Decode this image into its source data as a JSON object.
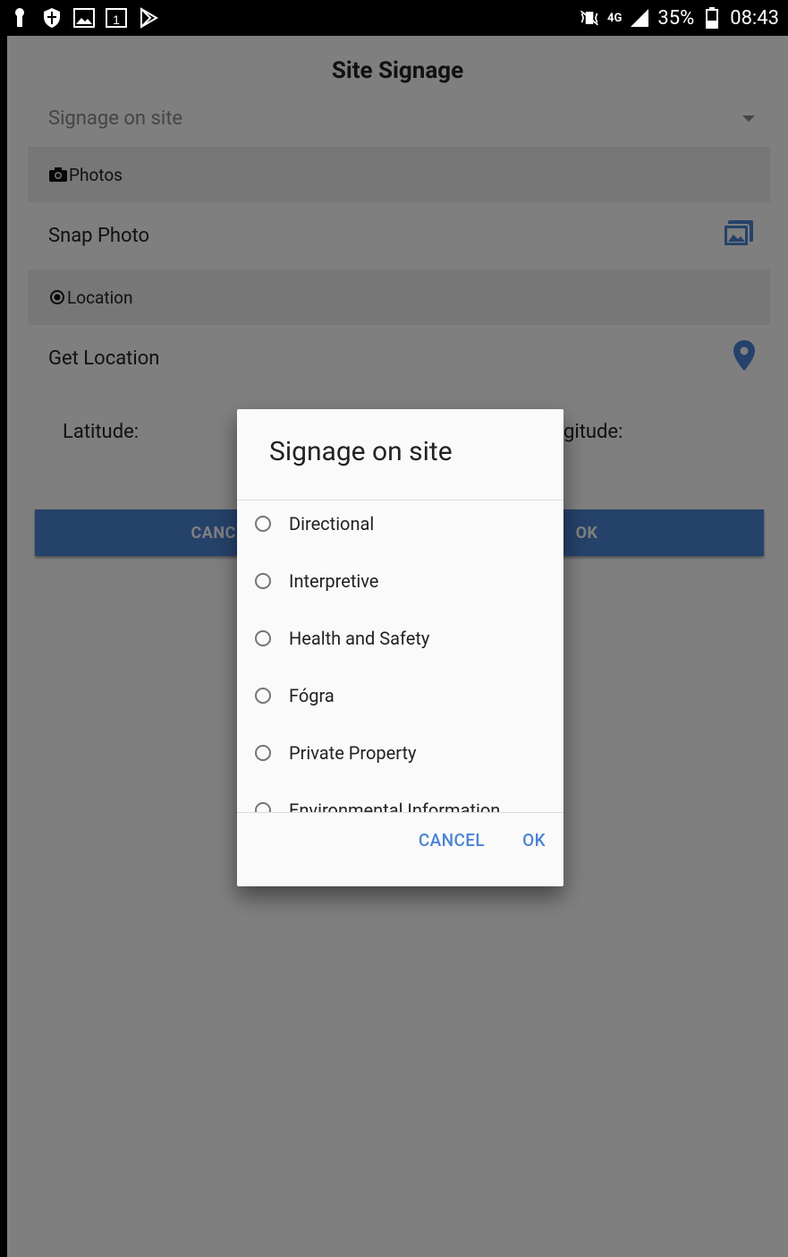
{
  "status_bar": {
    "battery": "35%",
    "time": "08:43",
    "network": "4G"
  },
  "page": {
    "title": "Site Signage",
    "dropdown_placeholder": "Signage on site",
    "photos_header": "Photos",
    "snap_photo": "Snap Photo",
    "location_header": "Location",
    "get_location": "Get Location",
    "latitude_label": "Latitude:",
    "longitude_label_partial": "gitude:",
    "cancel_button_partial": "CANCE",
    "ok_button": "OK"
  },
  "dialog": {
    "title": "Signage on site",
    "options": [
      "Directional",
      "Interpretive",
      "Health and Safety",
      "Fógra",
      "Private Property",
      "Environmental Information"
    ],
    "cancel": "CANCEL",
    "ok": "OK"
  },
  "colors": {
    "accent": "#4a84d4",
    "scrim": "rgba(0,0,0,0.5)",
    "section_bg": "#eeeeee"
  }
}
